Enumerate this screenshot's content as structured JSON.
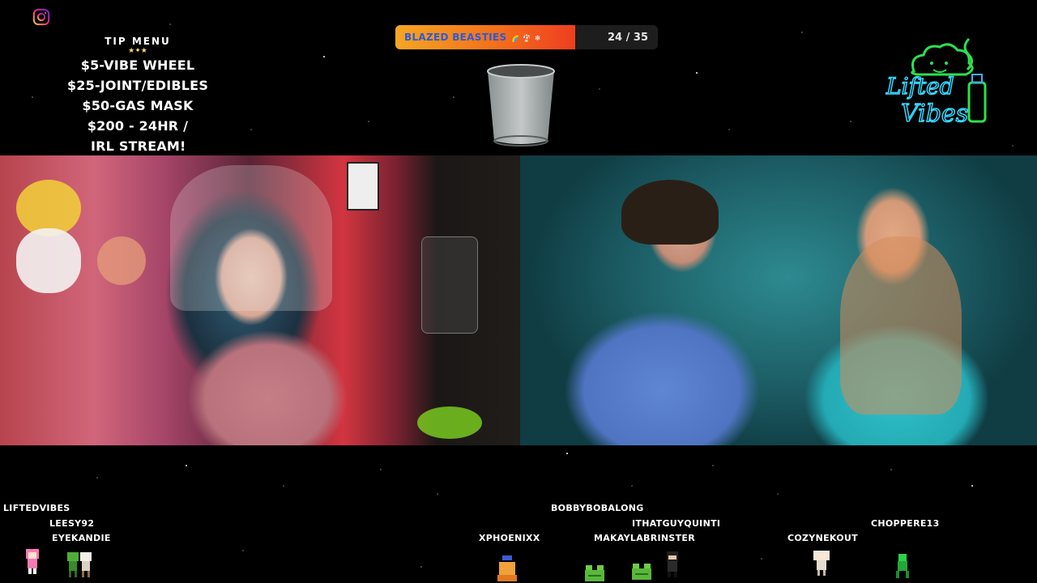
{
  "tip_menu": {
    "title": "TIP MENU",
    "stars": "★✦★",
    "lines": [
      "$5-VIBE WHEEL",
      "$25-JOINT/EDIBLES",
      "$50-GAS MASK",
      "$200 - 24HR /",
      "IRL STREAM!"
    ]
  },
  "goal": {
    "label": "BLAZED BEASTIES",
    "emojis": "🌈 🍄 ❄",
    "count": "24 / 35",
    "progress": 0.686,
    "color": "#f36b1b"
  },
  "logo": {
    "line1": "Lifted",
    "line2": "Vibes",
    "color": "#2de04d"
  },
  "icons": {
    "social": "instagram-icon",
    "cup": "cup-icon"
  },
  "viewers": {
    "names": [
      "LIFTEDVIBES",
      "LEESY92",
      "EYEKANDIE",
      "BOBBYBOBALONG",
      "ITHATGUYQUINTI",
      "XPHOENIXX",
      "MAKAYLABRINSTER",
      "CHOPPERE13",
      "COZYNEKOUT"
    ]
  }
}
